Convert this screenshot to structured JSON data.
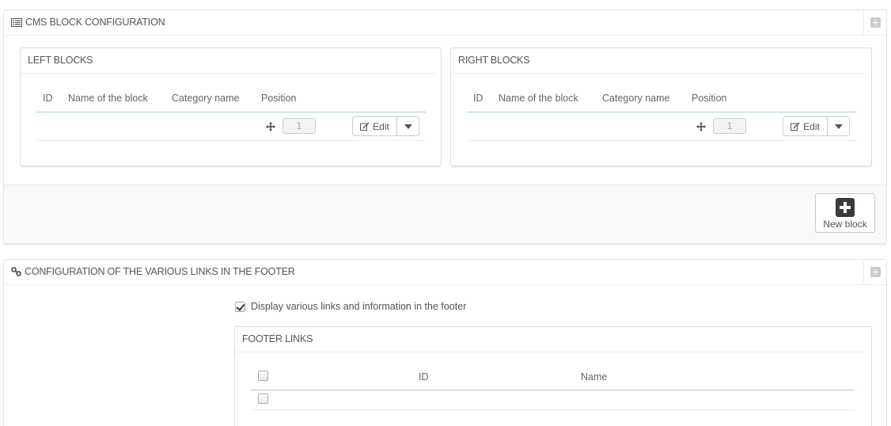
{
  "cms_panel": {
    "title": "CMS BLOCK CONFIGURATION",
    "left_blocks": {
      "title": "LEFT BLOCKS",
      "columns": [
        "ID",
        "Name of the block",
        "Category name",
        "Position"
      ],
      "row": {
        "position": "1",
        "edit_label": "Edit"
      }
    },
    "right_blocks": {
      "title": "RIGHT BLOCKS",
      "columns": [
        "ID",
        "Name of the block",
        "Category name",
        "Position"
      ],
      "row": {
        "position": "1",
        "edit_label": "Edit"
      }
    },
    "new_block_label": "New block"
  },
  "footer_panel": {
    "title": "CONFIGURATION OF THE VARIOUS LINKS IN THE FOOTER",
    "display_checkbox_label": "Display various links and information in the footer",
    "display_checked": true,
    "footer_links": {
      "title": "FOOTER LINKS",
      "columns": [
        "ID",
        "Name"
      ]
    }
  },
  "icons": [
    "list-icon",
    "link-icon",
    "plus-square-icon",
    "move-icon",
    "edit-icon",
    "caret-down-icon"
  ],
  "colors": {
    "table_header_rule": "#a0d0e0",
    "new_block_icon": "#363a41",
    "footer_bg": "#f7f9fb"
  }
}
